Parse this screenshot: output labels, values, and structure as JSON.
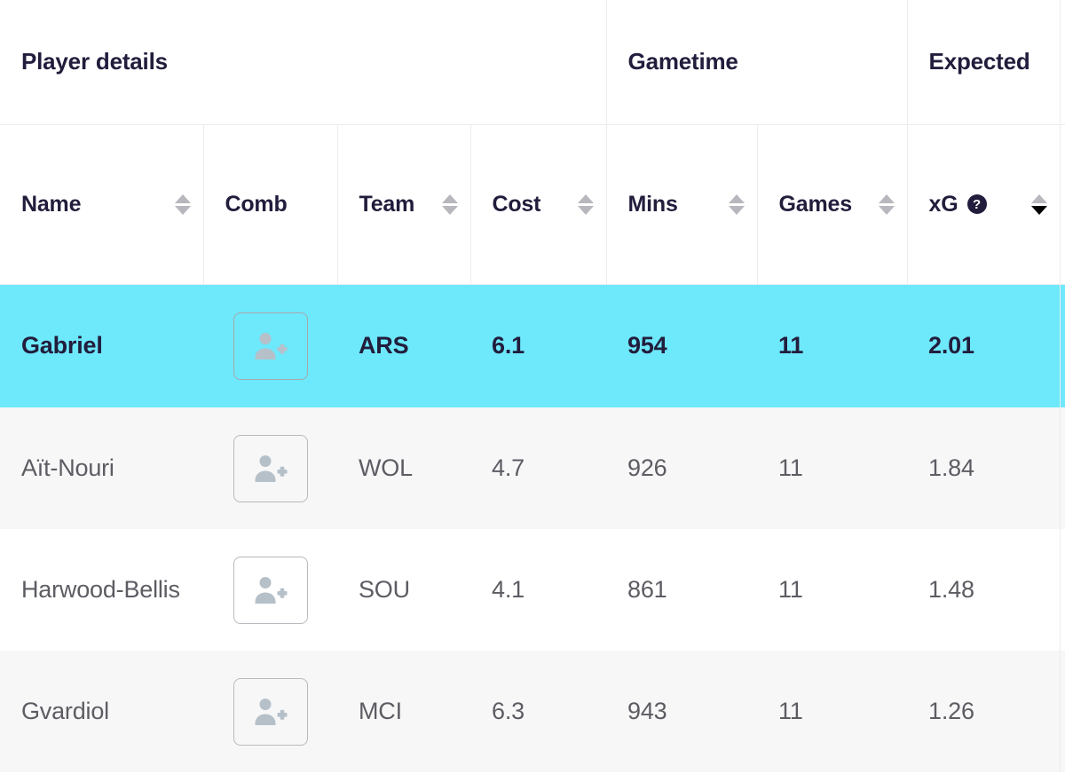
{
  "table": {
    "group_headers": [
      {
        "label": "Player details",
        "span": 4,
        "name": "player-details"
      },
      {
        "label": "Gametime",
        "span": 2,
        "name": "gametime"
      },
      {
        "label": "Expected",
        "span": 1,
        "name": "expected"
      }
    ],
    "columns": [
      {
        "key": "name",
        "label": "Name",
        "sortable": true,
        "sort_state": "none",
        "help": false
      },
      {
        "key": "comb",
        "label": "Comb",
        "sortable": false,
        "sort_state": "none",
        "help": false
      },
      {
        "key": "team",
        "label": "Team",
        "sortable": true,
        "sort_state": "none",
        "help": false
      },
      {
        "key": "cost",
        "label": "Cost",
        "sortable": true,
        "sort_state": "none",
        "help": false
      },
      {
        "key": "mins",
        "label": "Mins",
        "sortable": true,
        "sort_state": "none",
        "help": false
      },
      {
        "key": "games",
        "label": "Games",
        "sortable": true,
        "sort_state": "none",
        "help": false
      },
      {
        "key": "xg",
        "label": "xG",
        "sortable": true,
        "sort_state": "desc",
        "help": true,
        "help_glyph": "?"
      }
    ],
    "rows": [
      {
        "name": "Gabriel",
        "comb_action": "add-player",
        "team": "ARS",
        "cost": "6.1",
        "mins": "954",
        "games": "11",
        "xg": "2.01",
        "selected": true
      },
      {
        "name": "Aït-Nouri",
        "comb_action": "add-player",
        "team": "WOL",
        "cost": "4.7",
        "mins": "926",
        "games": "11",
        "xg": "1.84",
        "selected": false
      },
      {
        "name": "Harwood-Bellis",
        "comb_action": "add-player",
        "team": "SOU",
        "cost": "4.1",
        "mins": "861",
        "games": "11",
        "xg": "1.48",
        "selected": false
      },
      {
        "name": "Gvardiol",
        "comb_action": "add-player",
        "team": "MCI",
        "cost": "6.3",
        "mins": "943",
        "games": "11",
        "xg": "1.26",
        "selected": false
      }
    ]
  },
  "icons": {
    "add_person": "add-person-icon",
    "help": "help-circle-icon",
    "sort": "sort-arrows-icon"
  },
  "colors": {
    "selected_row": "#6ee8fb",
    "header_text": "#221d3c",
    "body_text": "#5c5c63",
    "alt_row": "#f7f7f8",
    "border": "#ececee",
    "sort_inactive": "#b7b7bd",
    "sort_active": "#000000",
    "icon_grey": "#b6c0c9"
  }
}
